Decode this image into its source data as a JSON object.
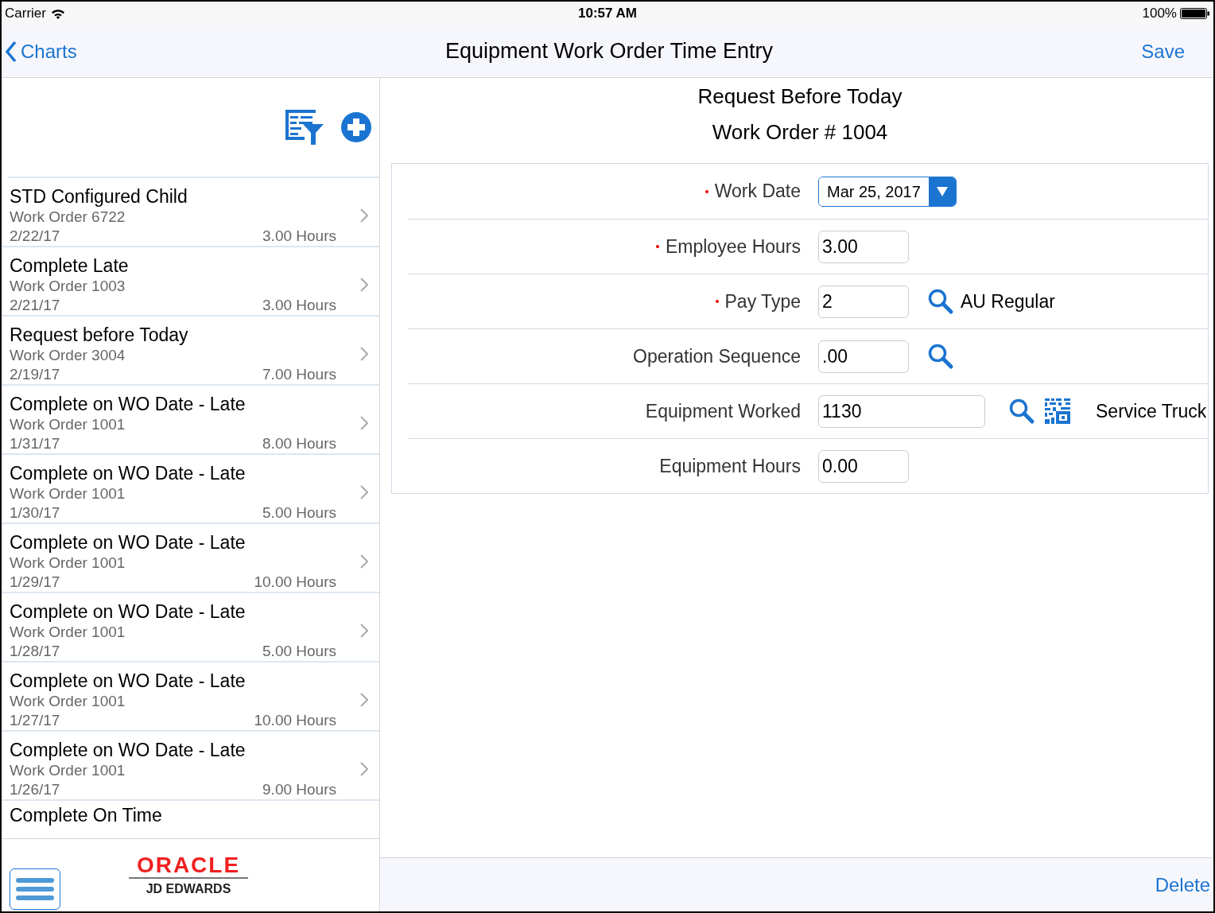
{
  "status_bar": {
    "carrier": "Carrier",
    "time": "10:57 AM",
    "battery": "100%"
  },
  "nav": {
    "back": "Charts",
    "title": "Equipment Work Order Time Entry",
    "action": "Save"
  },
  "list": [
    {
      "title": "STD Configured Child",
      "subtitle": "Work Order 6722",
      "date": "2/22/17",
      "hours": "3.00 Hours"
    },
    {
      "title": "Complete Late",
      "subtitle": "Work Order 1003",
      "date": "2/21/17",
      "hours": "3.00 Hours"
    },
    {
      "title": "Request before Today",
      "subtitle": "Work Order 3004",
      "date": "2/19/17",
      "hours": "7.00 Hours"
    },
    {
      "title": "Complete on WO Date - Late",
      "subtitle": "Work Order 1001",
      "date": "1/31/17",
      "hours": "8.00 Hours"
    },
    {
      "title": "Complete on WO Date - Late",
      "subtitle": "Work Order 1001",
      "date": "1/30/17",
      "hours": "5.00 Hours"
    },
    {
      "title": "Complete on WO Date - Late",
      "subtitle": "Work Order 1001",
      "date": "1/29/17",
      "hours": "10.00 Hours"
    },
    {
      "title": "Complete on WO Date - Late",
      "subtitle": "Work Order 1001",
      "date": "1/28/17",
      "hours": "5.00 Hours"
    },
    {
      "title": "Complete on WO Date - Late",
      "subtitle": "Work Order 1001",
      "date": "1/27/17",
      "hours": "10.00 Hours"
    },
    {
      "title": "Complete on WO Date - Late",
      "subtitle": "Work Order 1001",
      "date": "1/26/17",
      "hours": "9.00 Hours"
    }
  ],
  "list_partial_item": "Complete On Time",
  "logo": {
    "brand": "ORACLE",
    "product": "JD EDWARDS"
  },
  "detail": {
    "heading": "Request Before Today",
    "subheading": "Work Order # 1004"
  },
  "form": [
    {
      "kind": "date",
      "label": "Work Date",
      "required": true,
      "value": "Mar 25, 2017"
    },
    {
      "kind": "text",
      "label": "Employee Hours",
      "required": true,
      "value": "3.00",
      "wide": false,
      "lookup": false,
      "barcode": false
    },
    {
      "kind": "text",
      "label": "Pay Type",
      "required": true,
      "value": "2",
      "wide": false,
      "lookup": true,
      "barcode": false,
      "description": "AU Regular"
    },
    {
      "kind": "text",
      "label": "Operation Sequence",
      "required": false,
      "value": ".00",
      "wide": false,
      "lookup": true,
      "barcode": false
    },
    {
      "kind": "text",
      "label": "Equipment Worked",
      "required": false,
      "value": "1130",
      "wide": true,
      "lookup": true,
      "barcode": true,
      "description": "Service Truck"
    },
    {
      "kind": "text",
      "label": "Equipment Hours",
      "required": false,
      "value": "0.00",
      "wide": false,
      "lookup": false,
      "barcode": false
    }
  ],
  "footer": {
    "action": "Delete"
  }
}
